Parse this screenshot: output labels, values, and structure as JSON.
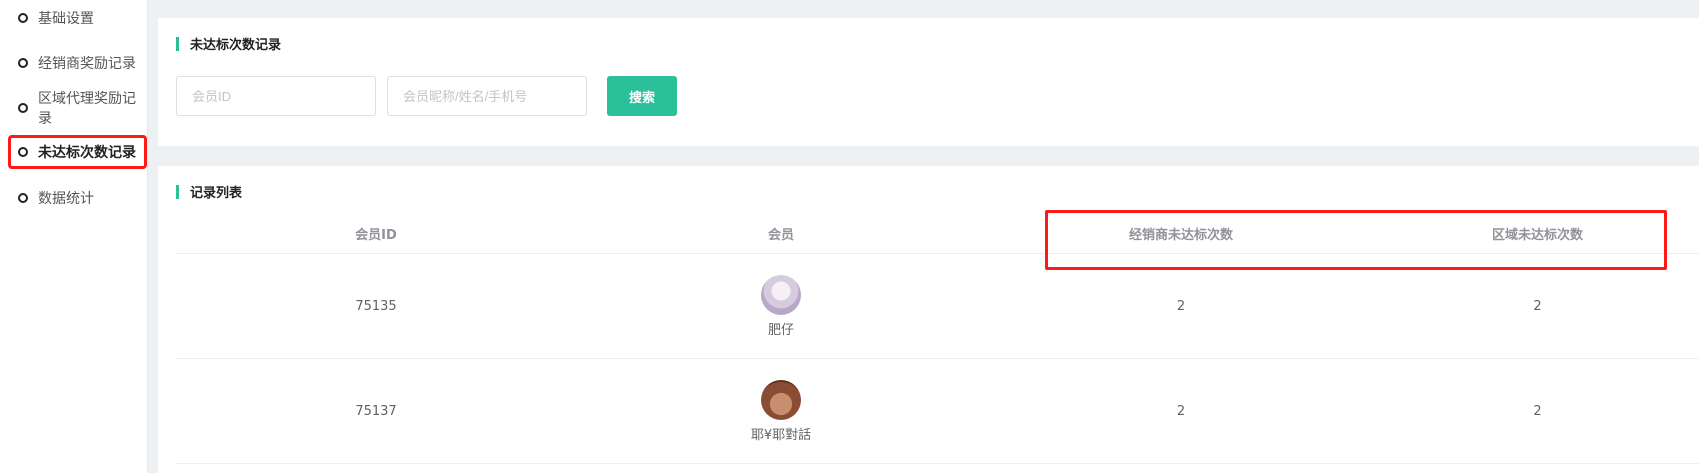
{
  "sidebar": {
    "items": [
      {
        "label": "基础设置",
        "active": false
      },
      {
        "label": "经销商奖励记录",
        "active": false
      },
      {
        "label": "区域代理奖励记录",
        "active": false
      },
      {
        "label": "未达标次数记录",
        "active": true
      },
      {
        "label": "数据统计",
        "active": false
      }
    ]
  },
  "search_panel": {
    "title": "未达标次数记录",
    "member_id_placeholder": "会员ID",
    "member_info_placeholder": "会员昵称/姓名/手机号",
    "search_button": "搜索"
  },
  "list_panel": {
    "title": "记录列表",
    "columns": [
      "会员ID",
      "会员",
      "经销商未达标次数",
      "区域未达标次数"
    ],
    "rows": [
      {
        "member_id": "75135",
        "member_name": "肥仔",
        "dealer_count": "2",
        "region_count": "2"
      },
      {
        "member_id": "75137",
        "member_name": "耶¥耶對話",
        "dealer_count": "2",
        "region_count": "2"
      }
    ]
  },
  "colors": {
    "accent": "#2bbf9a",
    "highlight": "#ff1a1a"
  }
}
